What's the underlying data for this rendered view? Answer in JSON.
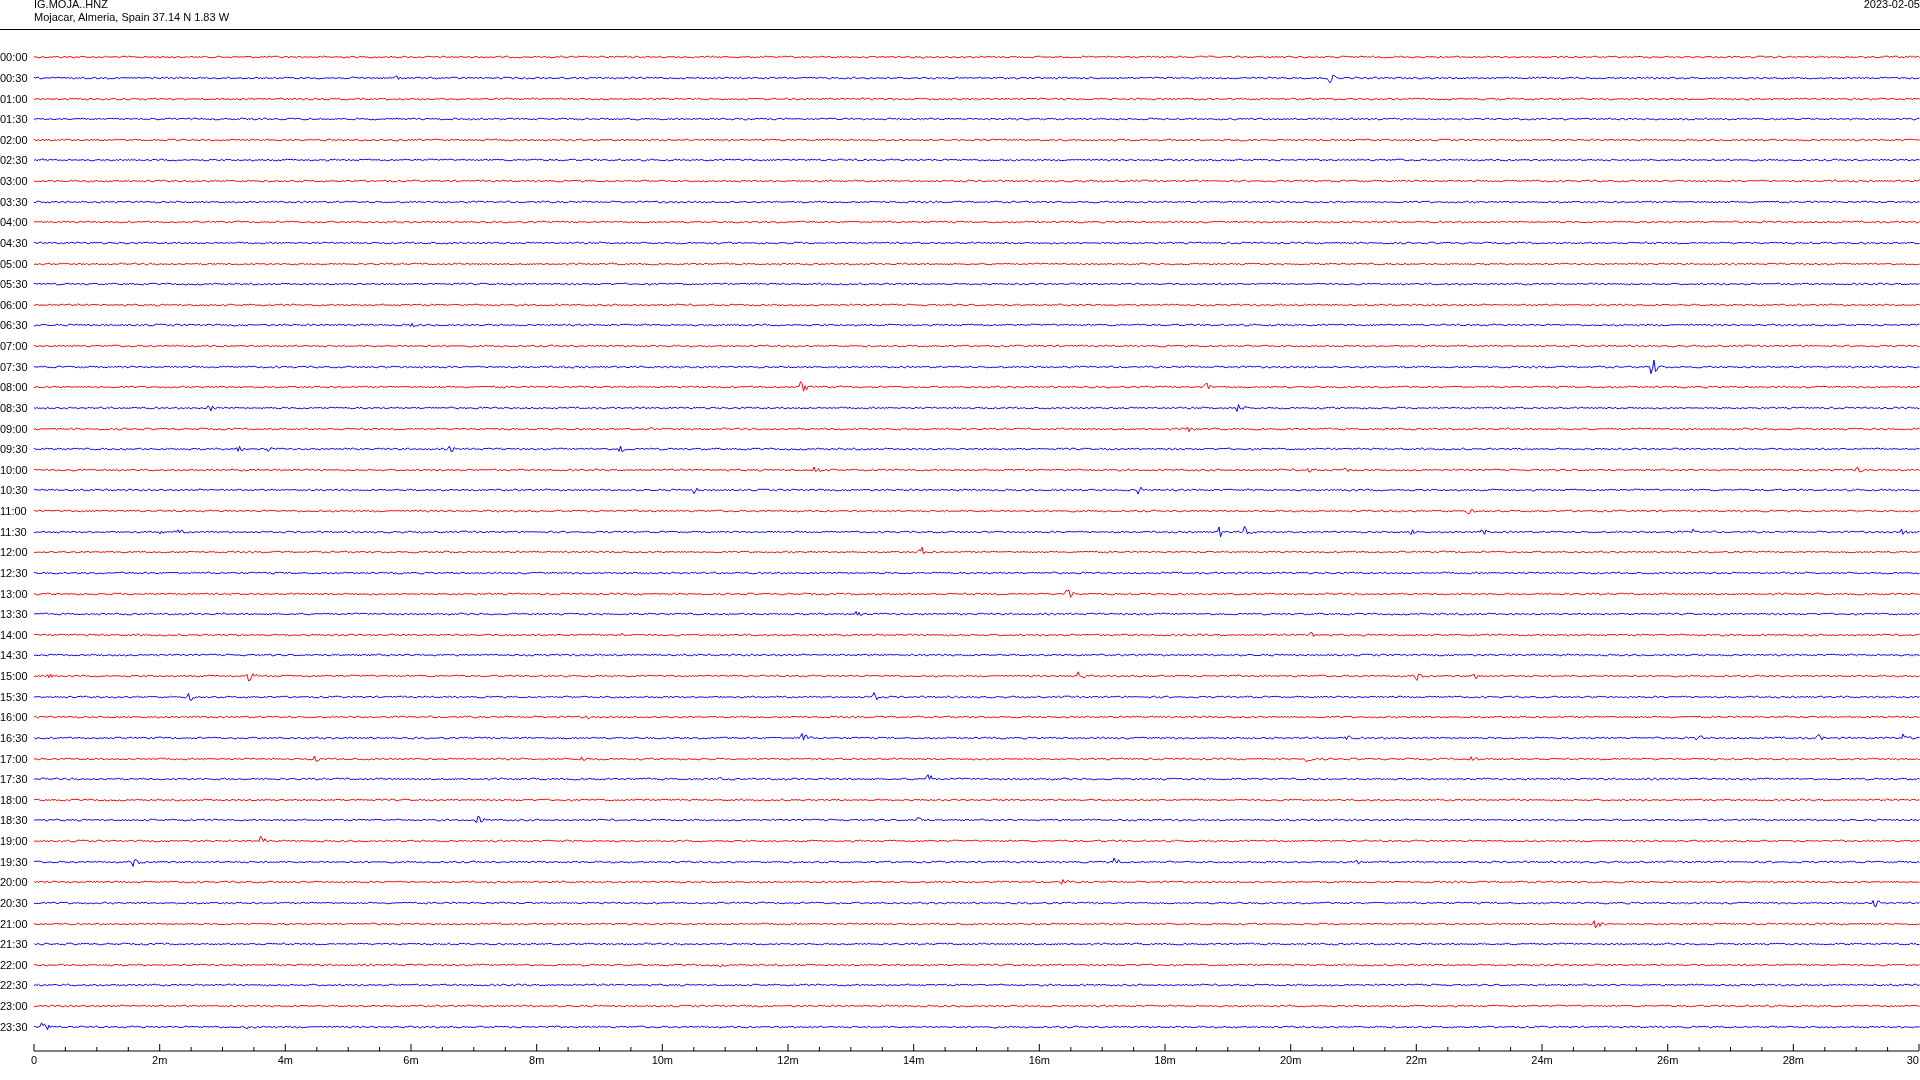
{
  "header": {
    "station": "IG.MOJA..HNZ",
    "location": "Mojacar, Almeria, Spain  37.14 N 1.83 W",
    "date": "2023-02-05"
  },
  "traces": [
    {
      "time": "00:00",
      "color": "#ff0000"
    },
    {
      "time": "00:30",
      "color": "#0000ff"
    },
    {
      "time": "01:00",
      "color": "#ff0000"
    },
    {
      "time": "01:30",
      "color": "#0000ff"
    },
    {
      "time": "02:00",
      "color": "#ff0000"
    },
    {
      "time": "02:30",
      "color": "#0000ff"
    },
    {
      "time": "03:00",
      "color": "#ff0000"
    },
    {
      "time": "03:30",
      "color": "#0000ff"
    },
    {
      "time": "04:00",
      "color": "#ff0000"
    },
    {
      "time": "04:30",
      "color": "#0000ff"
    },
    {
      "time": "05:00",
      "color": "#ff0000"
    },
    {
      "time": "05:30",
      "color": "#0000ff"
    },
    {
      "time": "06:00",
      "color": "#ff0000"
    },
    {
      "time": "06:30",
      "color": "#0000ff"
    },
    {
      "time": "07:00",
      "color": "#ff0000"
    },
    {
      "time": "07:30",
      "color": "#0000ff"
    },
    {
      "time": "08:00",
      "color": "#ff0000"
    },
    {
      "time": "08:30",
      "color": "#0000ff"
    },
    {
      "time": "09:00",
      "color": "#ff0000"
    },
    {
      "time": "09:30",
      "color": "#0000ff"
    },
    {
      "time": "10:00",
      "color": "#ff0000"
    },
    {
      "time": "10:30",
      "color": "#0000ff"
    },
    {
      "time": "11:00",
      "color": "#ff0000"
    },
    {
      "time": "11:30",
      "color": "#0000ff"
    },
    {
      "time": "12:00",
      "color": "#ff0000"
    },
    {
      "time": "12:30",
      "color": "#0000ff"
    },
    {
      "time": "13:00",
      "color": "#ff0000"
    },
    {
      "time": "13:30",
      "color": "#0000ff"
    },
    {
      "time": "14:00",
      "color": "#ff0000"
    },
    {
      "time": "14:30",
      "color": "#0000ff"
    },
    {
      "time": "15:00",
      "color": "#ff0000"
    },
    {
      "time": "15:30",
      "color": "#0000ff"
    },
    {
      "time": "16:00",
      "color": "#ff0000"
    },
    {
      "time": "16:30",
      "color": "#0000ff"
    },
    {
      "time": "17:00",
      "color": "#ff0000"
    },
    {
      "time": "17:30",
      "color": "#0000ff"
    },
    {
      "time": "18:00",
      "color": "#ff0000"
    },
    {
      "time": "18:30",
      "color": "#0000ff"
    },
    {
      "time": "19:00",
      "color": "#ff0000"
    },
    {
      "time": "19:30",
      "color": "#0000ff"
    },
    {
      "time": "20:00",
      "color": "#ff0000"
    },
    {
      "time": "20:30",
      "color": "#0000ff"
    },
    {
      "time": "21:00",
      "color": "#ff0000"
    },
    {
      "time": "21:30",
      "color": "#0000ff"
    },
    {
      "time": "22:00",
      "color": "#ff0000"
    },
    {
      "time": "22:30",
      "color": "#0000ff"
    },
    {
      "time": "23:00",
      "color": "#ff0000"
    },
    {
      "time": "23:30",
      "color": "#0000ff"
    }
  ],
  "time_axis": {
    "labels": [
      "0",
      "2m",
      "4m",
      "6m",
      "8m",
      "10m",
      "12m",
      "14m",
      "16m",
      "18m",
      "20m",
      "22m",
      "24m",
      "26m",
      "28m",
      "30"
    ]
  }
}
